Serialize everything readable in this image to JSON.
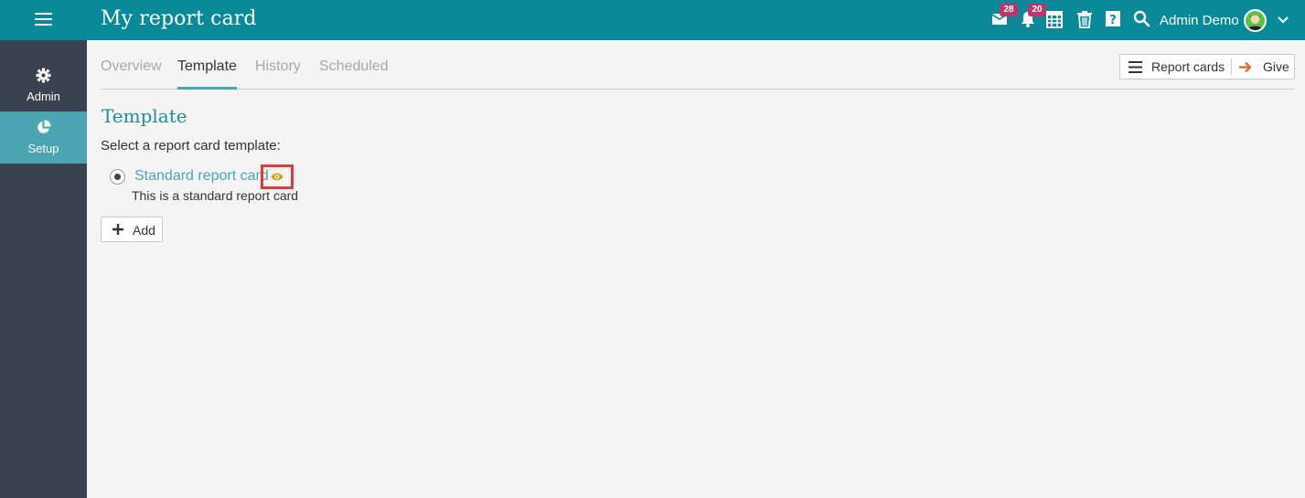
{
  "header": {
    "title": "My report card",
    "menu_icon": "hamburger-icon",
    "mail_badge": "28",
    "notifications_badge": "20",
    "user_name": "Admin Demo",
    "icons": [
      "mail-icon",
      "bell-icon",
      "calendar-icon",
      "trash-icon",
      "help-icon",
      "search-icon",
      "chevron-down-icon"
    ]
  },
  "sidebar": {
    "items": [
      {
        "label": "Admin",
        "icon": "gear-icon",
        "active": false
      },
      {
        "label": "Setup",
        "icon": "pie-chart-icon",
        "active": true
      }
    ]
  },
  "tabs": [
    {
      "label": "Overview",
      "active": false
    },
    {
      "label": "Template",
      "active": true
    },
    {
      "label": "History",
      "active": false
    },
    {
      "label": "Scheduled",
      "active": false
    }
  ],
  "actions": {
    "report_cards_label": "Report cards",
    "give_label": "Give"
  },
  "main": {
    "section_title": "Template",
    "select_label": "Select a report card template:",
    "template": {
      "name": "Standard report card",
      "description": "This is a standard report card",
      "selected": true
    },
    "add_label": "Add"
  },
  "colors": {
    "topbar": "#0a8a99",
    "sidebar": "#3a424f",
    "accent": "#4aa4b2",
    "badge": "#c0336b",
    "highlight_box": "#e8373a",
    "eye_icon": "#d4a000",
    "give_arrow": "#d9661f"
  }
}
